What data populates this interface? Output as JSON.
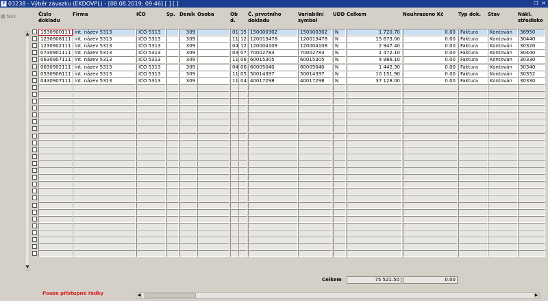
{
  "window": {
    "icon_label": "F",
    "title": "03238 - Výběr závazku (EKDOVPL) - [08.08.2019; 09:46]  [ ]  [ ]",
    "restore_icon": "restore-icon",
    "close_icon": "close-icon"
  },
  "nav": {
    "label": "Nav",
    "icon": "nav-icon"
  },
  "columns": [
    {
      "key": "cislo",
      "label": "Číslo dokladu"
    },
    {
      "key": "firma",
      "label": "Firma"
    },
    {
      "key": "ico",
      "label": "IČO"
    },
    {
      "key": "sp",
      "label": "Sp."
    },
    {
      "key": "denik",
      "label": "Deník"
    },
    {
      "key": "osoba",
      "label": "Osoba"
    },
    {
      "key": "obd",
      "label": "Ob d."
    },
    {
      "key": "prvotni",
      "label": "Č. prvotního dokladu"
    },
    {
      "key": "vs",
      "label": "Variabilní symbol"
    },
    {
      "key": "udd",
      "label": "UDD"
    },
    {
      "key": "celkem",
      "label": "Celkem"
    },
    {
      "key": "neuhr",
      "label": "Neuhrazeno Kč"
    },
    {
      "key": "typ",
      "label": "Typ dok."
    },
    {
      "key": "stav",
      "label": "Stav"
    },
    {
      "key": "nakl",
      "label": "Nákl. středisko"
    }
  ],
  "rows": [
    {
      "cislo": "1530900111",
      "firma": "int. název 5313",
      "ico": "IČO 5313",
      "sp": "",
      "denik": "309",
      "osoba": "",
      "ob1": "01",
      "ob2": "15",
      "prvotni": "150000302",
      "vs": "150000302",
      "udd": "N",
      "celkem": "1 720.70",
      "neuhr": "0.00",
      "typ": "Faktura",
      "stav": "Kontován",
      "nakl": "36950"
    },
    {
      "cislo": "1230908111",
      "firma": "int. název 5313",
      "ico": "IČO 5313",
      "sp": "",
      "denik": "309",
      "osoba": "",
      "ob1": "11",
      "ob2": "12",
      "prvotni": "120013478",
      "vs": "120013478",
      "udd": "N",
      "celkem": "15 673.00",
      "neuhr": "0.00",
      "typ": "Faktura",
      "stav": "Kontován",
      "nakl": "30440"
    },
    {
      "cislo": "1230902111",
      "firma": "int. název 5313",
      "ico": "IČO 5313",
      "sp": "",
      "denik": "309",
      "osoba": "",
      "ob1": "04",
      "ob2": "12",
      "prvotni": "120004108",
      "vs": "120004108",
      "udd": "N",
      "celkem": "2 947.40",
      "neuhr": "0.00",
      "typ": "Faktura",
      "stav": "Kontován",
      "nakl": "30320"
    },
    {
      "cislo": "0730901111",
      "firma": "int. název 5313",
      "ico": "IČO 5313",
      "sp": "",
      "denik": "309",
      "osoba": "",
      "ob1": "03",
      "ob2": "07",
      "prvotni": "70002783",
      "vs": "70002783",
      "udd": "N",
      "celkem": "1 472.10",
      "neuhr": "0.00",
      "typ": "Faktura",
      "stav": "Kontován",
      "nakl": "30440"
    },
    {
      "cislo": "0630907111",
      "firma": "int. název 5313",
      "ico": "IČO 5313",
      "sp": "",
      "denik": "309",
      "osoba": "",
      "ob1": "11",
      "ob2": "06",
      "prvotni": "60015305",
      "vs": "60015305",
      "udd": "N",
      "celkem": "4 986.10",
      "neuhr": "0.00",
      "typ": "Faktura",
      "stav": "Kontován",
      "nakl": "30330"
    },
    {
      "cislo": "0630902111",
      "firma": "int. název 5313",
      "ico": "IČO 5313",
      "sp": "",
      "denik": "309",
      "osoba": "",
      "ob1": "04",
      "ob2": "06",
      "prvotni": "60005040",
      "vs": "60005040",
      "udd": "N",
      "celkem": "1 442.30",
      "neuhr": "0.00",
      "typ": "Faktura",
      "stav": "Kontován",
      "nakl": "30340"
    },
    {
      "cislo": "0530906111",
      "firma": "int. název 5313",
      "ico": "IČO 5313",
      "sp": "",
      "denik": "309",
      "osoba": "",
      "ob1": "11",
      "ob2": "05",
      "prvotni": "50014397",
      "vs": "50014397",
      "udd": "N",
      "celkem": "10 151.90",
      "neuhr": "0.00",
      "typ": "Faktura",
      "stav": "Kontován",
      "nakl": "30352"
    },
    {
      "cislo": "0430907111",
      "firma": "int. název 5313",
      "ico": "IČO 5313",
      "sp": "",
      "denik": "309",
      "osoba": "",
      "ob1": "11",
      "ob2": "04",
      "prvotni": "40017298",
      "vs": "40017298",
      "udd": "N",
      "celkem": "37 128.00",
      "neuhr": "0.00",
      "typ": "Faktura",
      "stav": "Kontován",
      "nakl": "30330"
    }
  ],
  "empty_rows": 25,
  "totals": {
    "label": "Celkem",
    "celkem": "75 521.50",
    "neuhrazeno": "0.00"
  },
  "status": {
    "text": "Pouze přístupné řádky"
  },
  "scroll": {
    "up_icon": "scroll-up-icon",
    "down_icon": "scroll-down-icon",
    "left_icon": "scroll-left-icon",
    "right_icon": "scroll-right-icon"
  }
}
